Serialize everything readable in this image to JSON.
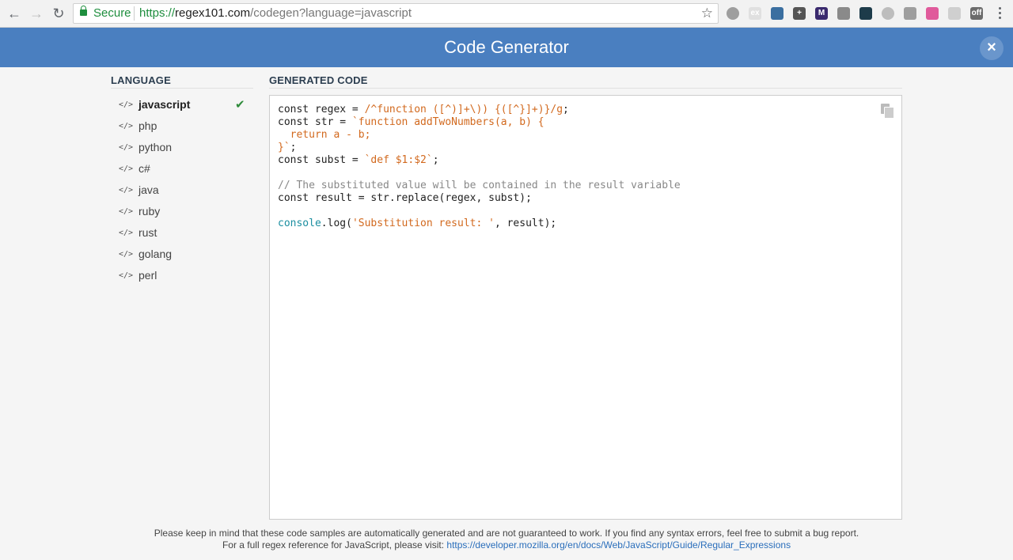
{
  "browser": {
    "security_label": "Secure",
    "url_scheme": "https://",
    "url_host": "regex101.com",
    "url_path": "/codegen?language=javascript",
    "extensions": [
      {
        "name": "speech-bubble-icon",
        "color": "#9e9e9e",
        "text": ""
      },
      {
        "name": "ex-extension-icon",
        "color": "#e0e0e0",
        "text": "ex"
      },
      {
        "name": "dev-extension-icon",
        "color": "#3b6fa0",
        "text": ""
      },
      {
        "name": "plus-extension-icon",
        "color": "#555555",
        "text": "+"
      },
      {
        "name": "m-extension-icon",
        "color": "#3a2a6e",
        "text": "M"
      },
      {
        "name": "camera-icon",
        "color": "#8a8a8a",
        "text": ""
      },
      {
        "name": "react-icon",
        "color": "#1d3b4a",
        "text": ""
      },
      {
        "name": "circle-extension-icon",
        "color": "#bdbdbd",
        "text": ""
      },
      {
        "name": "cloud-icon",
        "color": "#9e9e9e",
        "text": ""
      },
      {
        "name": "color-wheel-icon",
        "color": "#e05a9b",
        "text": ""
      },
      {
        "name": "refresh-extension-icon",
        "color": "#cfcfcf",
        "text": ""
      },
      {
        "name": "off-extension-icon",
        "color": "#6b6b6b",
        "text": "off"
      }
    ]
  },
  "header": {
    "title": "Code Generator",
    "close_icon": "×"
  },
  "sidebar": {
    "title": "LANGUAGE",
    "check_icon": "✔",
    "code_icon": "</>",
    "items": [
      {
        "label": "javascript",
        "active": true
      },
      {
        "label": "php"
      },
      {
        "label": "python"
      },
      {
        "label": "c#"
      },
      {
        "label": "java"
      },
      {
        "label": "ruby"
      },
      {
        "label": "rust"
      },
      {
        "label": "golang"
      },
      {
        "label": "perl"
      }
    ]
  },
  "code": {
    "title": "GENERATED CODE",
    "lines": {
      "l1_kw": "const",
      "l1_mid": " regex = ",
      "l1_str": "/^function ([^)]+\\)) {([^}]+)}/g",
      "l1_end": ";",
      "l2_kw": "const",
      "l2_mid": " str = ",
      "l2_str": "`function addTwoNumbers(a, b) {",
      "l3_str": "  return a - b;",
      "l4_str": "}`",
      "l4_end": ";",
      "l5_kw": "const",
      "l5_mid": " subst = ",
      "l5_str": "`def $1:$2`",
      "l5_end": ";",
      "l7_cmt": "// The substituted value will be contained in the result variable",
      "l8_kw": "const",
      "l8_mid": " result = str.replace(regex, subst);",
      "l10_fn": "console",
      "l10_mid": ".log(",
      "l10_str": "'Substitution result: '",
      "l10_end": ", result);"
    }
  },
  "footer": {
    "line1": "Please keep in mind that these code samples are automatically generated and are not guaranteed to work. If you find any syntax errors, feel free to submit a bug report.",
    "line2_prefix": "For a full regex reference for JavaScript, please visit: ",
    "line2_link": "https://developer.mozilla.org/en/docs/Web/JavaScript/Guide/Regular_Expressions"
  }
}
